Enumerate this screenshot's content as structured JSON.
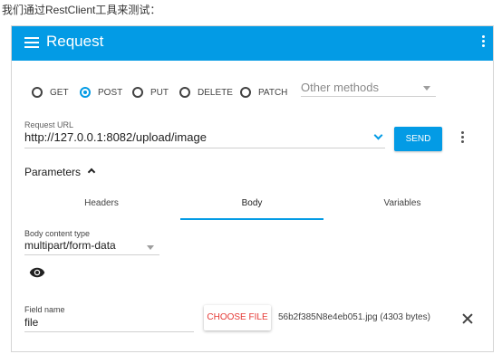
{
  "intro_text": "我们通过RestClient工具来测试：",
  "appbar": {
    "title": "Request",
    "accent": "#039be5"
  },
  "methods": [
    {
      "label": "GET",
      "checked": false
    },
    {
      "label": "POST",
      "checked": true
    },
    {
      "label": "PUT",
      "checked": false
    },
    {
      "label": "DELETE",
      "checked": false
    },
    {
      "label": "PATCH",
      "checked": false
    }
  ],
  "other_methods": {
    "placeholder": "Other methods"
  },
  "request_url": {
    "label": "Request URL",
    "value": "http://127.0.0.1:8082/upload/image"
  },
  "send_button": {
    "label": "SEND"
  },
  "parameters": {
    "label": "Parameters"
  },
  "tabs": [
    {
      "label": "Headers",
      "active": false
    },
    {
      "label": "Body",
      "active": true
    },
    {
      "label": "Variables",
      "active": false
    }
  ],
  "body_content_type": {
    "label": "Body content type",
    "value": "multipart/form-data"
  },
  "field": {
    "label": "Field name",
    "value": "file"
  },
  "choose_file": {
    "label": "CHOOSE FILE",
    "color": "#e53935"
  },
  "file_info": "56b2f385N8e4eb051.jpg (4303 bytes)",
  "icons": [
    "menu-icon",
    "more-vert-icon",
    "chevron-down-icon",
    "chevron-up-icon",
    "dropdown-caret-icon",
    "eye-icon",
    "close-icon"
  ]
}
